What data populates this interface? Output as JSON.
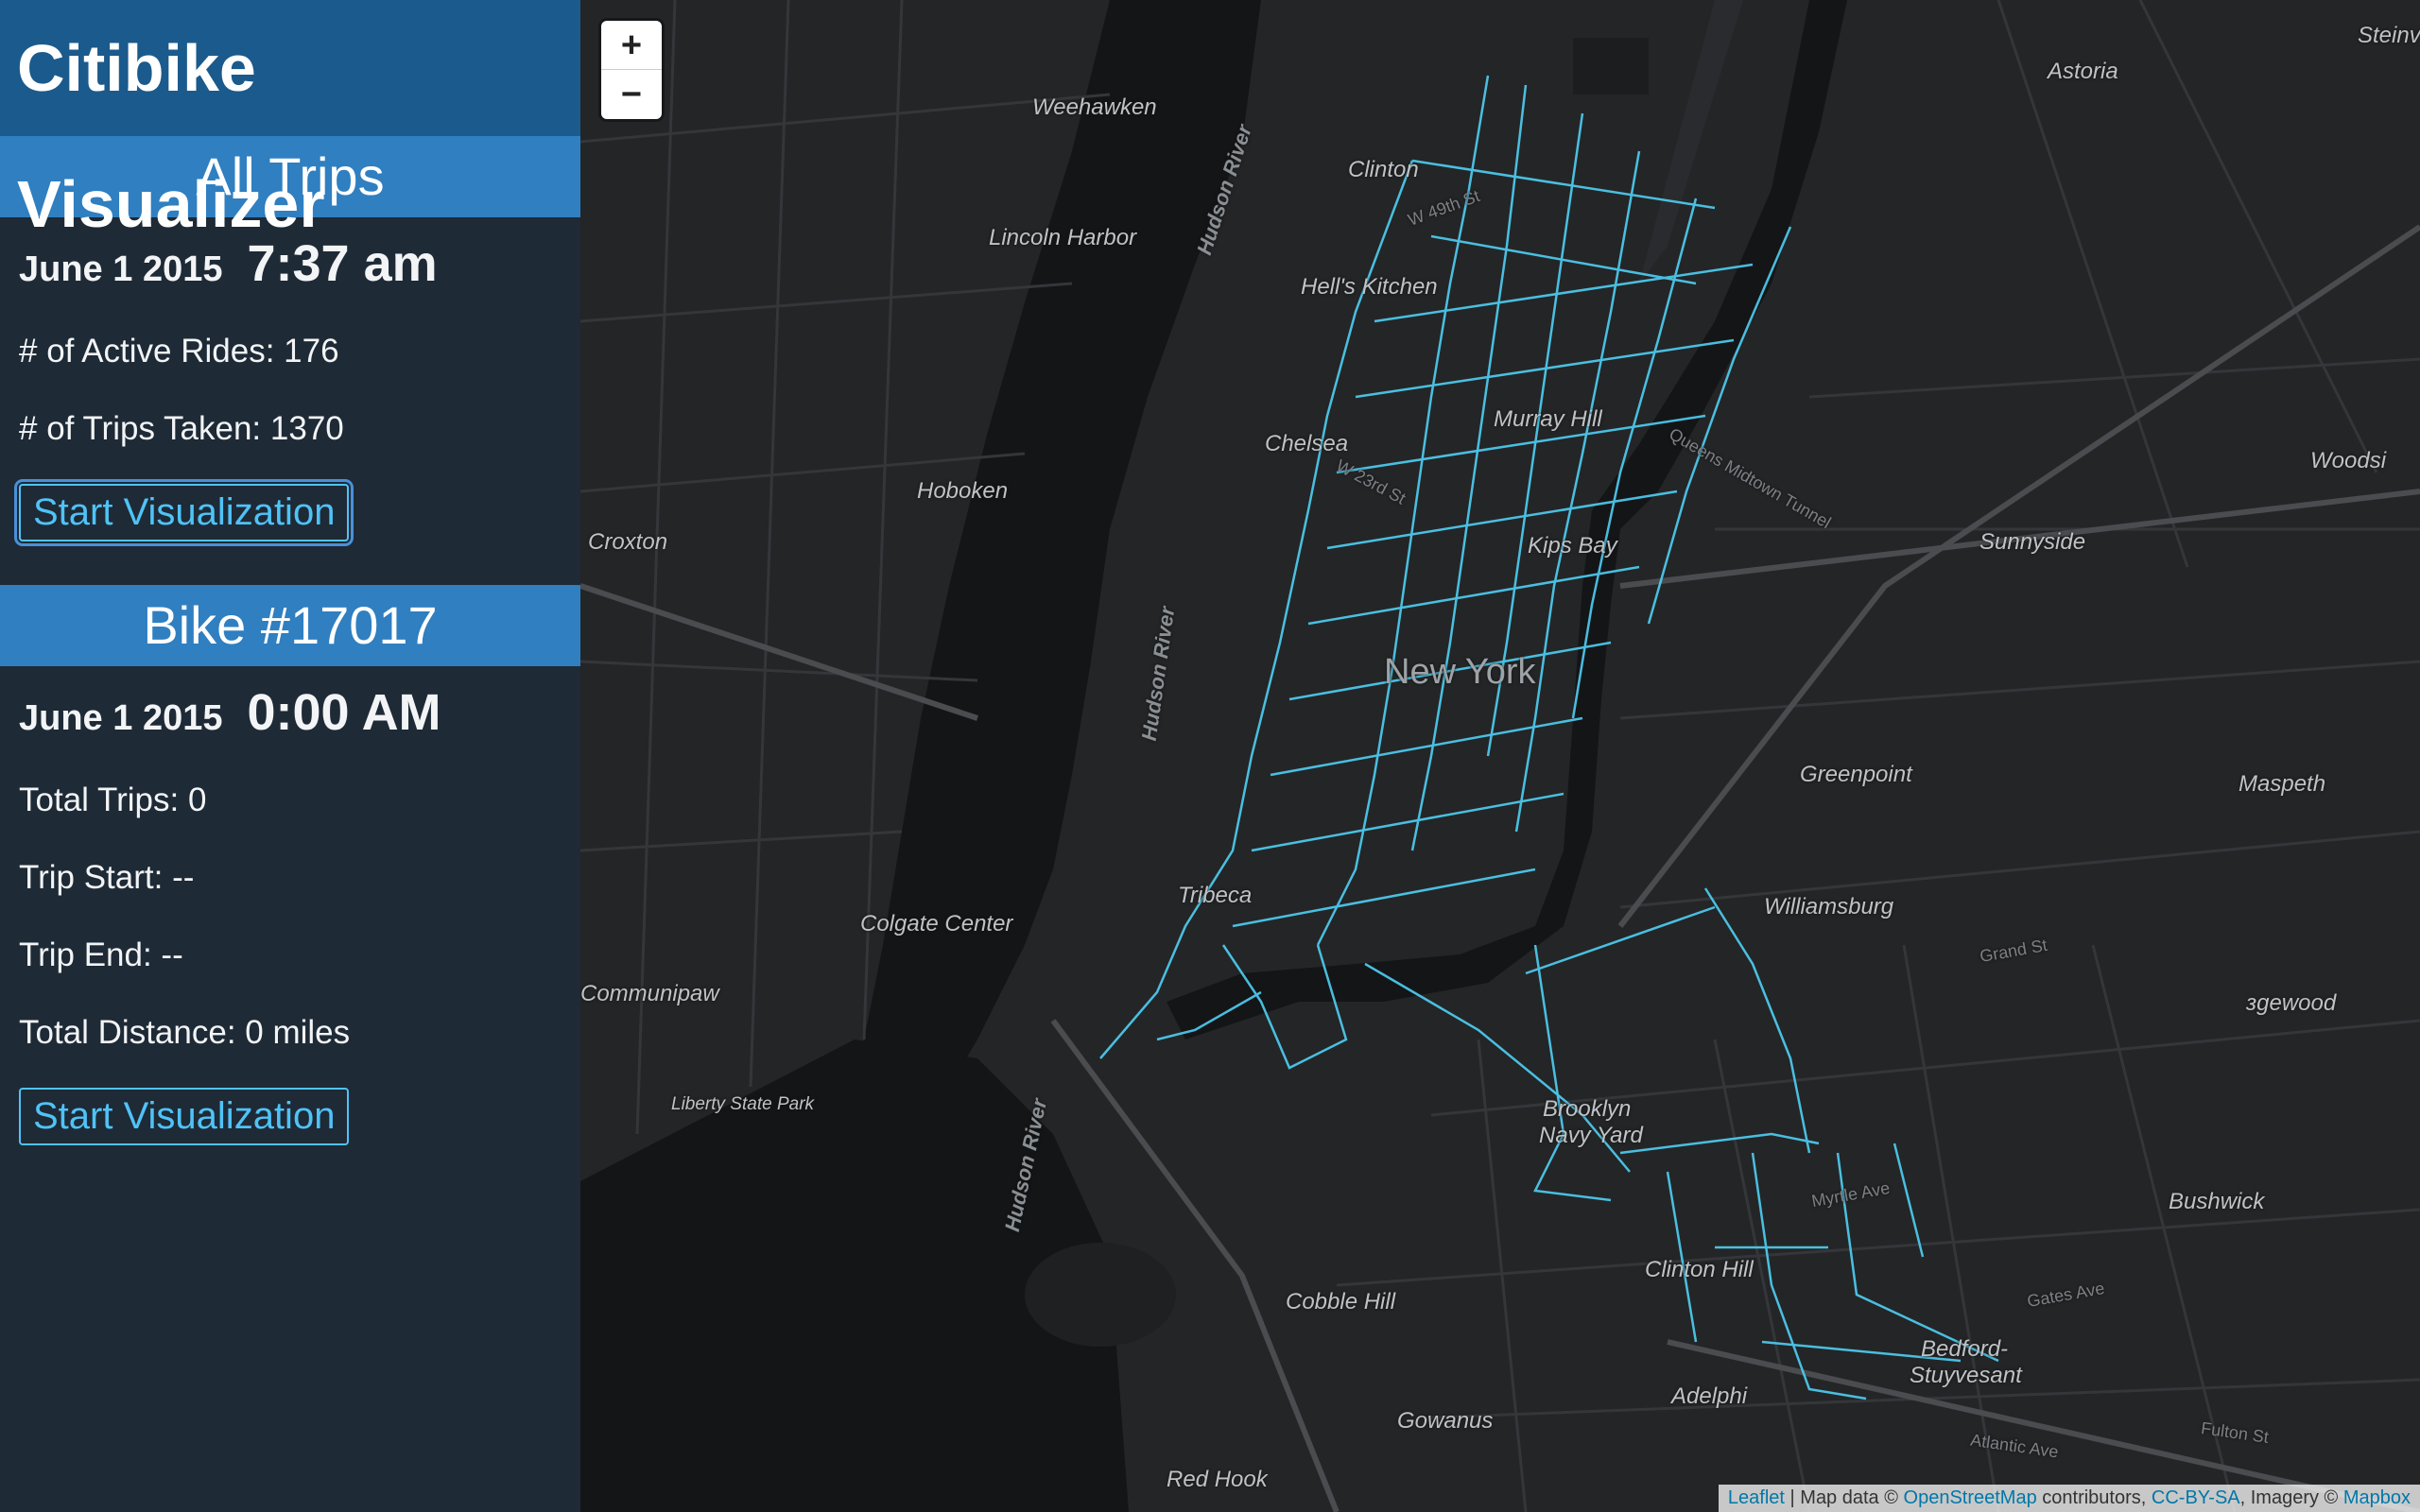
{
  "app": {
    "title": "Citibike Visualizer"
  },
  "all_trips": {
    "header": "All Trips",
    "date": "June 1 2015",
    "time": "7:37 am",
    "active_rides": "# of Active Rides: 176",
    "trips_taken": "# of Trips Taken: 1370",
    "button": "Start Visualization"
  },
  "bike": {
    "header": "Bike #17017",
    "date": "June 1 2015",
    "time": "0:00 AM",
    "total_trips": "Total Trips: 0",
    "trip_start": "Trip Start: --",
    "trip_end": "Trip End: --",
    "total_distance": "Total Distance: 0 miles",
    "button": "Start Visualization"
  },
  "map": {
    "zoom_in": "+",
    "zoom_out": "−",
    "labels": {
      "weehawken": "Weehawken",
      "clinton": "Clinton",
      "astoria": "Astoria",
      "lincoln_harbor": "Lincoln Harbor",
      "hells_kitchen": "Hell's Kitchen",
      "murray_hill": "Murray Hill",
      "chelsea": "Chelsea",
      "hoboken": "Hoboken",
      "croxton": "Croxton",
      "kips_bay": "Kips Bay",
      "sunnyside": "Sunnyside",
      "woodside": "Woodsi",
      "new_york": "New York",
      "greenpoint": "Greenpoint",
      "maspeth": "Maspeth",
      "tribeca": "Tribeca",
      "williamsburg": "Williamsburg",
      "colgate_center": "Colgate Center",
      "communipaw": "Communipaw",
      "liberty_state_park": "Liberty State Park",
      "brooklyn_navy_yard_1": "Brooklyn",
      "brooklyn_navy_yard_2": "Navy Yard",
      "ridgewood": "ɜgewood",
      "clinton_hill": "Clinton Hill",
      "bushwick": "Bushwick",
      "cobble_hill": "Cobble Hill",
      "bedford_1": "Bedford-",
      "bedford_2": "Stuyvesant",
      "adelphi": "Adelphi",
      "gowanus": "Gowanus",
      "red_hook": "Red Hook",
      "hudson_river_1": "Hudson River",
      "hudson_river_2": "Hudson River",
      "hudson_river_3": "Hudson River",
      "steinway": "Steinv",
      "grand_st": "Grand St",
      "myrtle_ave": "Myrtle Ave",
      "gates_ave": "Gates Ave",
      "atlantic_ave": "Atlantic Ave",
      "fulton_st": "Fulton St",
      "queens_midtown": "Queens Midtown Tunnel",
      "w49": "W 49th St",
      "w23": "W 23rd St"
    },
    "attribution": {
      "leaflet": "Leaflet",
      "text1": " | Map data © ",
      "osm": "OpenStreetMap",
      "text2": " contributors, ",
      "ccbysa": "CC-BY-SA",
      "text3": ", Imagery © ",
      "mapbox": "Mapbox"
    },
    "colors": {
      "route": "#4fd0f5",
      "land": "#242527",
      "water": "#141517",
      "road": "#3c3e41"
    }
  }
}
